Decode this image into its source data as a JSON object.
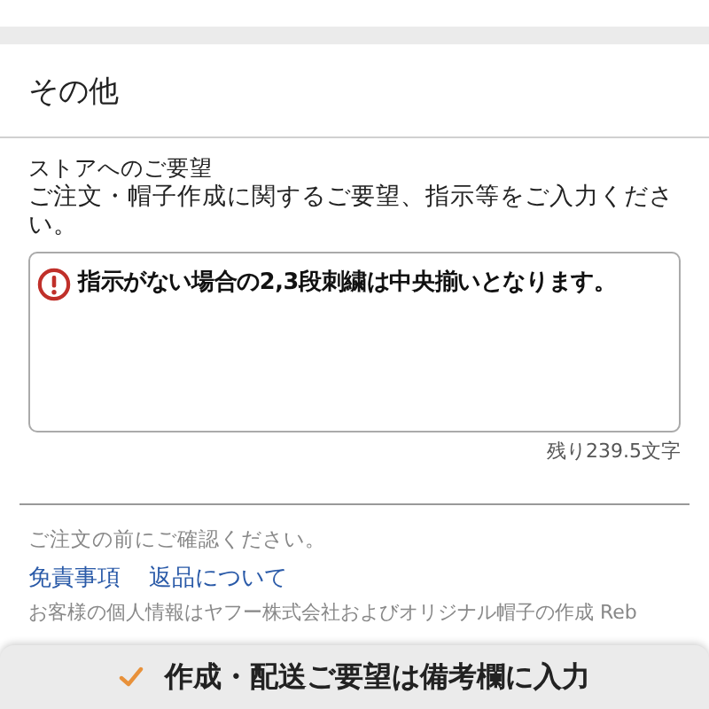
{
  "section": {
    "title": "その他"
  },
  "request": {
    "label": "ストアへのご要望",
    "description": "ご注文・帽子作成に関するご要望、指示等をご入力ください。",
    "warning": "指示がない場合の2,3段刺繍は中央揃いとなります。",
    "counter": "残り239.5文字"
  },
  "notice": "ご注文の前にご確認ください。",
  "links": [
    "免責事項",
    "返品について"
  ],
  "privacy": "お客様の個人情報はヤフー株式会社およびオリジナル帽子の作成 Reb",
  "bottom_bar": {
    "label": "作成・配送ご要望は備考欄に入力"
  }
}
